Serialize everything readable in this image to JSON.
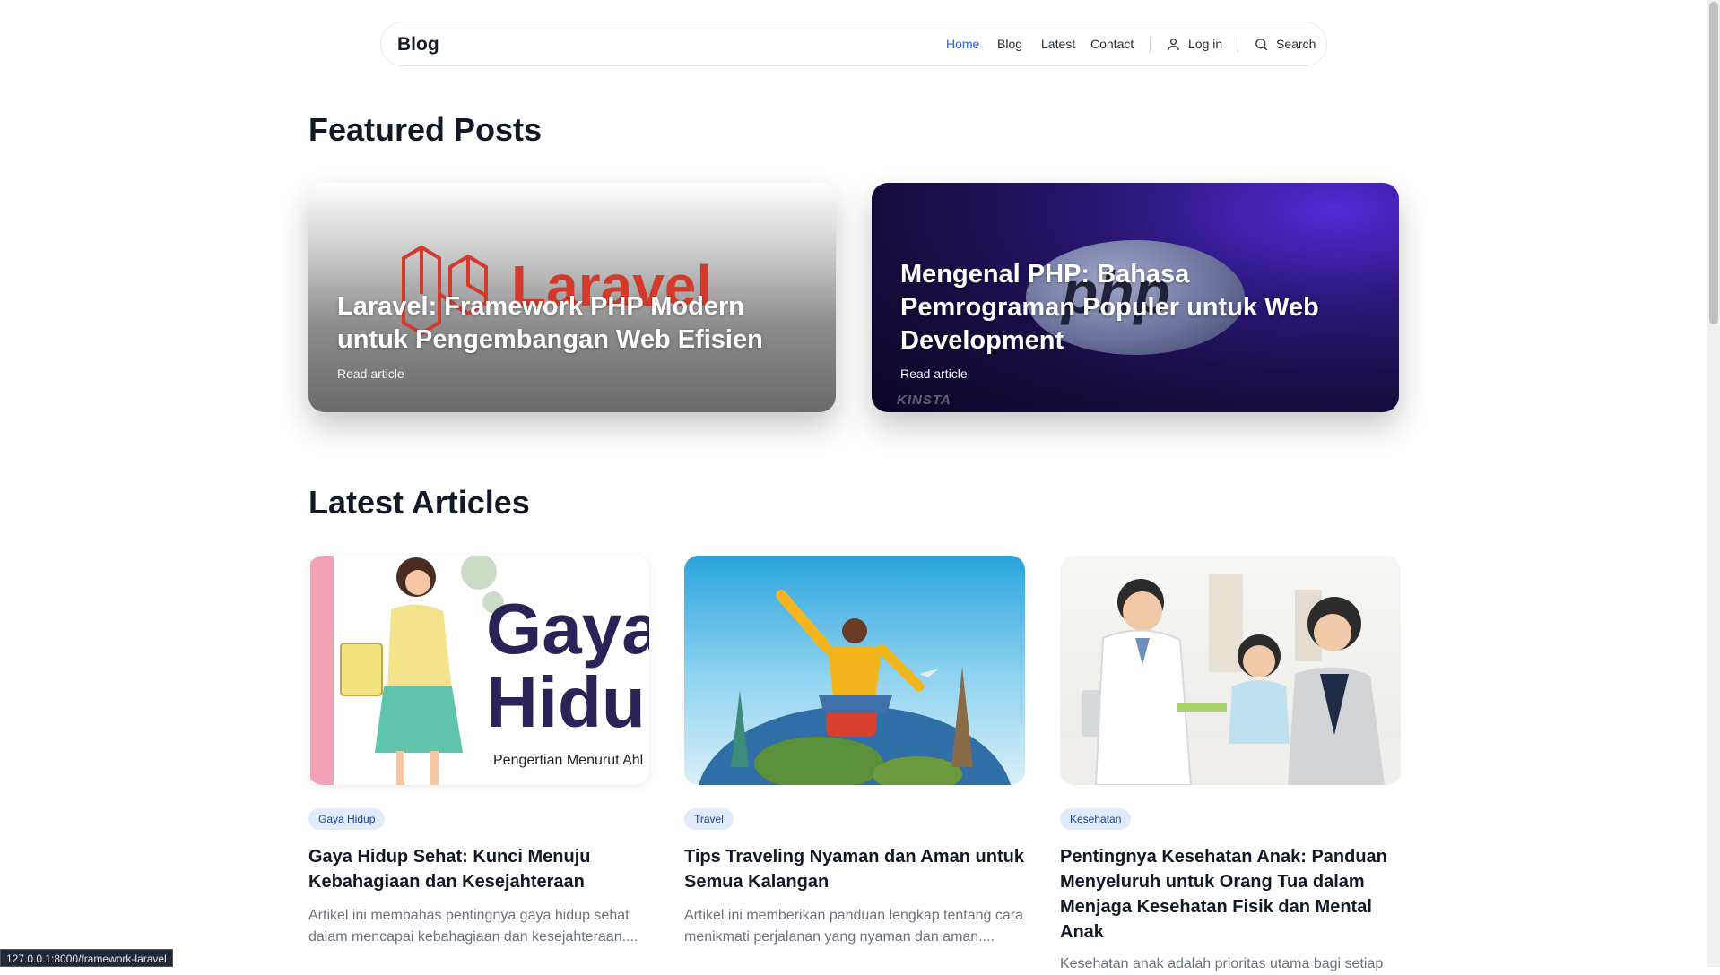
{
  "navbar": {
    "brand": "Blog",
    "links": [
      "Home",
      "Blog",
      "Latest",
      "Contact"
    ],
    "login_label": "Log in",
    "search_label": "Search"
  },
  "featured": {
    "title": "Featured Posts",
    "posts": [
      {
        "title": "Laravel: Framework PHP Modern untuk Pengembangan Web Efisien",
        "link_label": "Read article",
        "image_text": "Laravel"
      },
      {
        "title": "Mengenal PHP: Bahasa Pemrograman Populer untuk Web Development",
        "link_label": "Read article",
        "image_text": "php",
        "watermark": "KINSTA"
      }
    ]
  },
  "latest": {
    "title": "Latest Articles",
    "articles": [
      {
        "category": "Gaya Hidup",
        "title": "Gaya Hidup Sehat: Kunci Menuju Kebahagiaan dan Kesejahteraan",
        "excerpt": "Artikel ini membahas pentingnya gaya hidup sehat dalam mencapai kebahagiaan dan kesejahteraan....",
        "image_text_1": "Gaya",
        "image_text_2": "Hidu",
        "image_caption": "Pengertian Menurut Ahl"
      },
      {
        "category": "Travel",
        "title": "Tips Traveling Nyaman dan Aman untuk Semua Kalangan",
        "excerpt": "Artikel ini memberikan panduan lengkap tentang cara menikmati perjalanan yang nyaman dan aman...."
      },
      {
        "category": "Kesehatan",
        "title": "Pentingnya Kesehatan Anak: Panduan Menyeluruh untuk Orang Tua dalam Menjaga Kesehatan Fisik dan Mental Anak",
        "excerpt": "Kesehatan anak adalah prioritas utama bagi setiap"
      }
    ]
  },
  "status_url": "127.0.0.1:8000/framework-laravel",
  "colors": {
    "accent": "#2563eb",
    "badge_bg": "#e0ecfb",
    "badge_text": "#1e40af",
    "laravel_red": "#d33a2c"
  }
}
